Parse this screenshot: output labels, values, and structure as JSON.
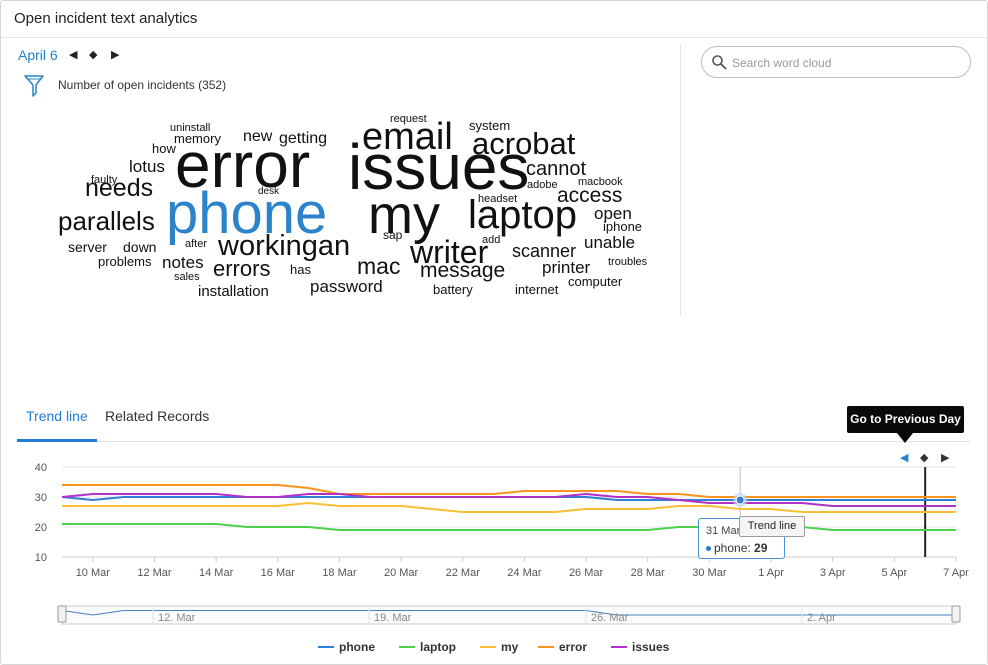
{
  "header": {
    "title": "Open incident text analytics"
  },
  "date_nav": {
    "date": "April 6",
    "prev": "◀",
    "play": "◆",
    "next": "▶"
  },
  "filter": {
    "icon": "funnel-icon",
    "label": "Number of open incidents (352)"
  },
  "search": {
    "placeholder": "Search word cloud",
    "value": ""
  },
  "word_cloud": {
    "highlight_color": "#2b83c9",
    "words": [
      {
        "text": "error"
      },
      {
        "text": "issues"
      },
      {
        "text": "phone",
        "highlight": true
      },
      {
        "text": "my"
      },
      {
        "text": "email"
      },
      {
        "text": "acrobat"
      },
      {
        "text": "laptop"
      },
      {
        "text": "workingan"
      },
      {
        "text": "writer"
      },
      {
        "text": "needs"
      },
      {
        "text": "parallels"
      },
      {
        "text": "errors"
      },
      {
        "text": "mac"
      },
      {
        "text": "message"
      },
      {
        "text": "access"
      },
      {
        "text": "cannot"
      },
      {
        "text": "scanner"
      },
      {
        "text": "unable"
      },
      {
        "text": "open"
      },
      {
        "text": "printer"
      },
      {
        "text": "password"
      },
      {
        "text": "notes"
      },
      {
        "text": "lotus"
      },
      {
        "text": "new"
      },
      {
        "text": "getting"
      },
      {
        "text": "installation"
      },
      {
        "text": "server"
      },
      {
        "text": "down"
      },
      {
        "text": "memory"
      },
      {
        "text": "uninstall"
      },
      {
        "text": "how"
      },
      {
        "text": "faulty"
      },
      {
        "text": "problems"
      },
      {
        "text": "sales"
      },
      {
        "text": "after"
      },
      {
        "text": "desk"
      },
      {
        "text": "has"
      },
      {
        "text": "sap"
      },
      {
        "text": "add"
      },
      {
        "text": "headset"
      },
      {
        "text": "adobe"
      },
      {
        "text": "macbook"
      },
      {
        "text": "iphone"
      },
      {
        "text": "troubles"
      },
      {
        "text": "computer"
      },
      {
        "text": "internet"
      },
      {
        "text": "battery"
      },
      {
        "text": "request"
      },
      {
        "text": "system"
      }
    ]
  },
  "tabs": [
    {
      "label": "Trend line",
      "active": true
    },
    {
      "label": "Related Records",
      "active": false
    }
  ],
  "prev_day_tooltip": "Go to Previous Day",
  "trend_nav": {
    "prev": "◀",
    "play": "◆",
    "next": "▶"
  },
  "point_tooltip": {
    "date": "31 Mar",
    "series": "phone",
    "value": "29"
  },
  "mini_tooltip": "Trend line",
  "chart_data": {
    "type": "line",
    "x": [
      "9 Mar",
      "10 Mar",
      "11 Mar",
      "12 Mar",
      "13 Mar",
      "14 Mar",
      "15 Mar",
      "16 Mar",
      "17 Mar",
      "18 Mar",
      "19 Mar",
      "20 Mar",
      "21 Mar",
      "22 Mar",
      "23 Mar",
      "24 Mar",
      "25 Mar",
      "26 Mar",
      "27 Mar",
      "28 Mar",
      "29 Mar",
      "30 Mar",
      "31 Mar",
      "1 Apr",
      "2 Apr",
      "3 Apr",
      "4 Apr",
      "5 Apr",
      "6 Apr",
      "7 Apr"
    ],
    "x_ticks": [
      "10 Mar",
      "12 Mar",
      "14 Mar",
      "16 Mar",
      "18 Mar",
      "20 Mar",
      "22 Mar",
      "24 Mar",
      "26 Mar",
      "28 Mar",
      "30 Mar",
      "1 Apr",
      "3 Apr",
      "5 Apr",
      "7 Apr"
    ],
    "ylim": [
      10,
      40
    ],
    "y_ticks": [
      10,
      20,
      30,
      40
    ],
    "grid": true,
    "legend_position": "bottom",
    "current_day": "6 Apr",
    "series": [
      {
        "name": "phone",
        "color": "#2f7ed8",
        "values": [
          30,
          29,
          30,
          30,
          30,
          30,
          30,
          30,
          30,
          30,
          30,
          30,
          30,
          30,
          30,
          30,
          30,
          30,
          29,
          29,
          29,
          29,
          29,
          29,
          29,
          29,
          29,
          29,
          29,
          29
        ]
      },
      {
        "name": "laptop",
        "color": "#4cd14c",
        "values": [
          21,
          21,
          21,
          21,
          21,
          21,
          20,
          20,
          20,
          19,
          19,
          19,
          19,
          19,
          19,
          19,
          19,
          19,
          19,
          19,
          20,
          20,
          20,
          20,
          20,
          19,
          19,
          19,
          19,
          19
        ]
      },
      {
        "name": "my",
        "color": "#f7bf34",
        "values": [
          27,
          27,
          27,
          27,
          27,
          27,
          27,
          27,
          28,
          27,
          27,
          27,
          26,
          25,
          25,
          25,
          25,
          26,
          26,
          26,
          27,
          27,
          26,
          26,
          25,
          25,
          25,
          25,
          25,
          25
        ]
      },
      {
        "name": "error",
        "color": "#f7941d",
        "values": [
          34,
          34,
          34,
          34,
          34,
          34,
          34,
          34,
          33,
          31,
          31,
          31,
          31,
          31,
          31,
          32,
          32,
          32,
          32,
          31,
          31,
          30,
          30,
          30,
          30,
          30,
          30,
          30,
          30,
          30
        ]
      },
      {
        "name": "issues",
        "color": "#b030c8",
        "values": [
          30,
          31,
          31,
          31,
          31,
          31,
          30,
          30,
          31,
          31,
          30,
          30,
          30,
          30,
          30,
          30,
          30,
          31,
          30,
          30,
          29,
          28,
          28,
          28,
          28,
          27,
          27,
          27,
          27,
          27
        ]
      }
    ],
    "navigator_ticks": [
      "12. Mar",
      "19. Mar",
      "26. Mar",
      "2. Apr"
    ]
  }
}
